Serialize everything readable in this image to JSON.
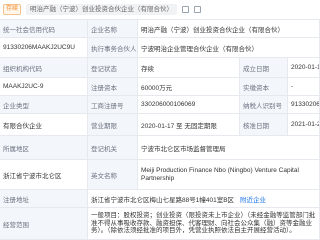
{
  "header": {
    "status_tag": "存续",
    "company_name": "明治产融（宁波）创业投资合伙企业（有限合伙）"
  },
  "info": {
    "credit_code_label": "统一社会信用代码",
    "credit_code": "91330206MAAKJ2UC9U",
    "name_label": "企业名称",
    "name": "明治产融（宁波）创业投资合伙企业（有限合伙）",
    "partner_label": "执行事务合伙人",
    "partner": "宁波明治企业管理合伙企业（有限合伙）",
    "org_code_label": "组织机构代码",
    "org_code": "MAAKJ2UC-9",
    "status_label": "登记状态",
    "status": "存续",
    "founded_label": "成立日期",
    "founded": "2020-01-17",
    "capital_label": "注册资本",
    "capital": "60000万元",
    "paid_label": "实缴资本",
    "paid": "-",
    "type_label": "企业类型",
    "type": "有限合伙企业",
    "reg_no_label": "工商注册号",
    "reg_no": "330206000106069",
    "tax_label": "纳税人识别号",
    "tax": "91330206MAAKJ2UC9U",
    "term_label": "营业期限",
    "term": "2020-01-17 至 无固定期限",
    "approved_label": "核准日期",
    "approved": "2021-01-29",
    "region_label": "所属地区",
    "region": "浙江省宁波市北仑区",
    "authority_label": "登记机关",
    "authority": "宁波市北仑区市场监督管理局",
    "en_name_label": "英文名称",
    "en_name": "Meiji Production Finance Nbo (Ningbo) Venture Capital Partnership",
    "address_label": "注册地址",
    "address": "浙江省宁波市北仑区梅山七星路88号1幢401室B区",
    "nearby_link": "附近企业",
    "scope_label": "经营范围",
    "scope": "一般项目：股权投资；创业投资（限投资未上市企业）（未经金融等监管部门批准不得从事吸收存款、融资担保、代客理财、向社会公众集（融）资等金融业务）。（除依法须经批准的项目外，凭营业执照依法自主开展经营活动）。"
  }
}
